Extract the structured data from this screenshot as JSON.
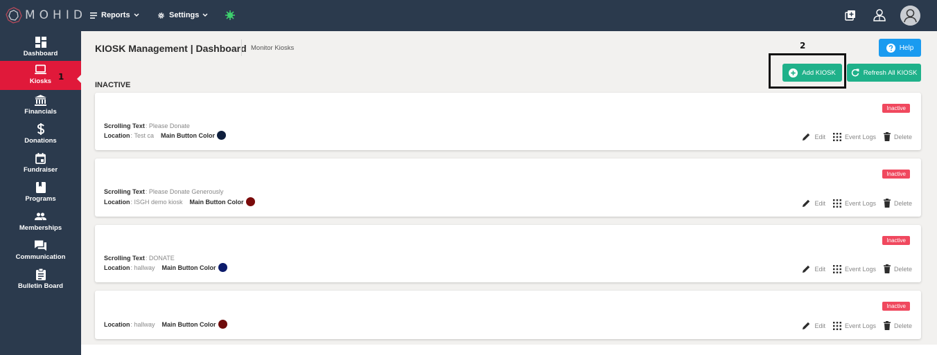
{
  "app": {
    "logo_text": "MOHID"
  },
  "topnav": {
    "reports_label": "Reports",
    "settings_label": "Settings"
  },
  "sidebar": {
    "items": [
      {
        "label": "Dashboard",
        "icon": "dashboard-icon"
      },
      {
        "label": "Kiosks",
        "icon": "laptop-icon"
      },
      {
        "label": "Financials",
        "icon": "bank-icon"
      },
      {
        "label": "Donations",
        "icon": "dollar-icon"
      },
      {
        "label": "Fundraiser",
        "icon": "calendar-icon"
      },
      {
        "label": "Programs",
        "icon": "book-icon"
      },
      {
        "label": "Memberships",
        "icon": "people-icon"
      },
      {
        "label": "Communication",
        "icon": "chat-icon"
      },
      {
        "label": "Bulletin Board",
        "icon": "clipboard-icon"
      }
    ]
  },
  "annotations": {
    "marker_1": "1",
    "marker_2": "2"
  },
  "header": {
    "title": "KIOSK Management | Dashboard",
    "breadcrumb": "Monitor Kiosks",
    "help_label": "Help"
  },
  "toolbar": {
    "add_label": "Add KIOSK",
    "refresh_label": "Refresh All KIOSK"
  },
  "section": {
    "label": "INACTIVE"
  },
  "labels": {
    "scrolling_text": "Scrolling Text",
    "location": "Location",
    "main_button_color": "Main Button Color",
    "edit": "Edit",
    "event_logs": "Event Logs",
    "delete": "Delete"
  },
  "kiosks": [
    {
      "status": "Inactive",
      "scrolling_text": "Please Donate",
      "location": "Test ca",
      "button_color": "#0f1f3d"
    },
    {
      "status": "Inactive",
      "scrolling_text": "Please Donate Generously",
      "location": "ISGH demo kiosk",
      "button_color": "#7a0a0a"
    },
    {
      "status": "Inactive",
      "scrolling_text": "DONATE",
      "location": "hallway",
      "button_color": "#0c1b6b"
    },
    {
      "status": "Inactive",
      "scrolling_text": "",
      "location": "hallway",
      "button_color": "#6e0b0b"
    }
  ],
  "colors": {
    "sidebar_bg": "#2b3a4d",
    "active_red": "#e0193a",
    "green": "#1fb18a",
    "help_blue": "#1a9bf0",
    "badge_red": "#f0485e"
  }
}
